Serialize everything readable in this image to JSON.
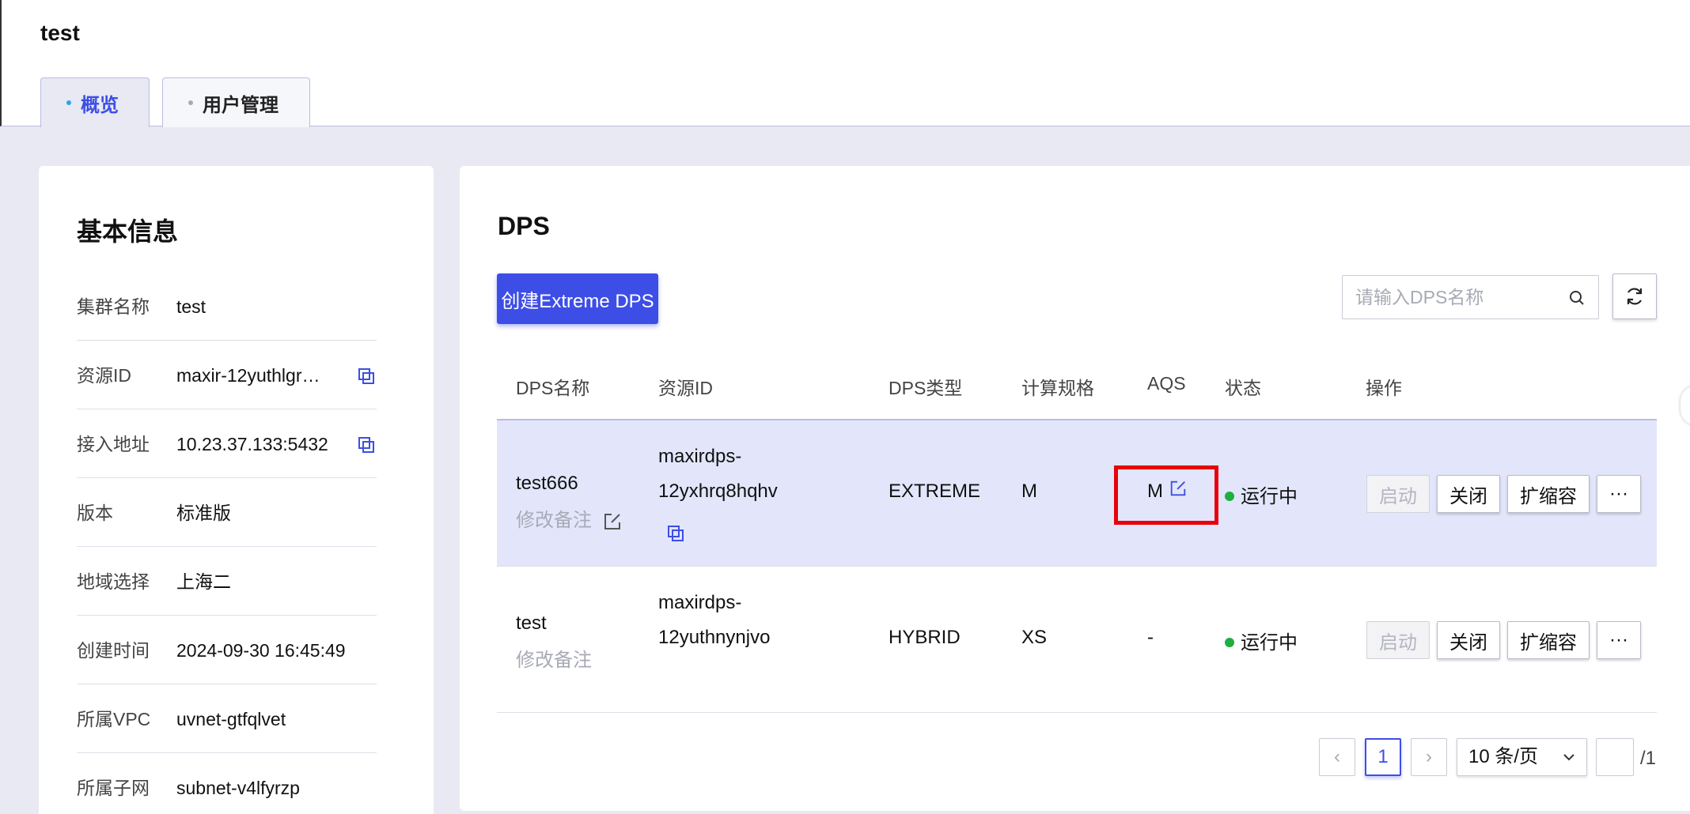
{
  "page": {
    "title": "test"
  },
  "tabs": [
    {
      "label": "概览",
      "active": true
    },
    {
      "label": "用户管理",
      "active": false
    }
  ],
  "basic_info": {
    "title": "基本信息",
    "rows": [
      {
        "label": "集群名称",
        "value": "test"
      },
      {
        "label": "资源ID",
        "value": "maxir-12yuthlgr…",
        "copyable": true
      },
      {
        "label": "接入地址",
        "value": "10.23.37.133:5432",
        "copyable": true
      },
      {
        "label": "版本",
        "value": "标准版"
      },
      {
        "label": "地域选择",
        "value": "上海二"
      },
      {
        "label": "创建时间",
        "value": "2024-09-30 16:45:49"
      },
      {
        "label": "所属VPC",
        "value": "uvnet-gtfqlvet"
      },
      {
        "label": "所属子网",
        "value": "subnet-v4lfyrzp"
      }
    ]
  },
  "dps": {
    "title": "DPS",
    "create_button": "创建Extreme DPS",
    "search_placeholder": "请输入DPS名称",
    "columns": [
      "DPS名称",
      "资源ID",
      "DPS类型",
      "计算规格",
      "AQS",
      "状态",
      "操作"
    ],
    "rows": [
      {
        "name": "test666",
        "remark": "修改备注",
        "resource_id_line1": "maxirdps-",
        "resource_id_line2": "12yxhrq8hqhv",
        "type": "EXTREME",
        "spec": "M",
        "aqs": "M",
        "status": "运行中",
        "actions": {
          "start": "启动",
          "close": "关闭",
          "scale": "扩缩容",
          "more": "···"
        }
      },
      {
        "name": "test",
        "remark": "修改备注",
        "resource_id_line1": "maxirdps-",
        "resource_id_line2": "12yuthnynjvo",
        "type": "HYBRID",
        "spec": "XS",
        "aqs": "-",
        "status": "运行中",
        "actions": {
          "start": "启动",
          "close": "关闭",
          "scale": "扩缩容",
          "more": "···"
        }
      }
    ],
    "pagination": {
      "prev": "‹",
      "next": "›",
      "current_page": "1",
      "page_size": "10 条/页",
      "total_pages": "/1"
    }
  },
  "colors": {
    "accent": "#3d4ee6",
    "status_running": "#1fae3f",
    "highlight_box": "#e8000b",
    "selected_row": "#e3e6fb"
  }
}
